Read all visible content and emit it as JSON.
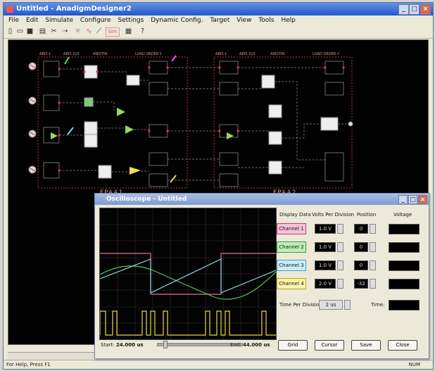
{
  "window": {
    "title": "Untitled - AnadigmDesigner2"
  },
  "menu": [
    "File",
    "Edit",
    "Simulate",
    "Configure",
    "Settings",
    "Dynamic Config.",
    "Target",
    "View",
    "Tools",
    "Help"
  ],
  "toolbar_icons": [
    "new-file-icon",
    "open-folder-icon",
    "save-icon",
    "print-icon",
    "cut-icon",
    "wire-icon",
    "delete-icon",
    "sine-wave-icon",
    "oscilloscope-icon",
    "simulate-icon",
    "chip-icon",
    "help-icon"
  ],
  "toolbar_labels": {
    "sim": "Sim"
  },
  "canvas": {
    "fpaa1_label": "FPAA1",
    "fpaa2_label": "FPAA2",
    "top_labels_1": [
      "ABIS 1",
      "ABIS 215",
      "ANISTIN",
      "LOAD ORDER 1"
    ],
    "top_labels_2": [
      "ABIS 1",
      "ABIS 215",
      "ANISTIN",
      "LOAD ORDER 2"
    ]
  },
  "status": {
    "left": "For Help, Press F1",
    "right": "NUM"
  },
  "oscilloscope": {
    "title": "Oscilloscope - Untitled",
    "headers": {
      "display": "Display Data",
      "volts": "Volts Per Division",
      "position": "Position",
      "voltage": "Voltage"
    },
    "channels": [
      {
        "label": "Channel 1",
        "volts": "1.0 V",
        "position": "0",
        "color": "#e66fa6",
        "bg": "#f4c3da"
      },
      {
        "label": "Channel 2",
        "volts": "1.0 V",
        "position": "0",
        "color": "#5bbf5b",
        "bg": "#bff0b0"
      },
      {
        "label": "Channel 3",
        "volts": "1.0 V",
        "position": "0",
        "color": "#8fd3e6",
        "bg": "#c9eef8"
      },
      {
        "label": "Channel 4",
        "volts": "2.0 V",
        "position": "-32",
        "color": "#e8d84a",
        "bg": "#fbf3a6"
      }
    ],
    "time_per_division_label": "Time Per Division:",
    "time_per_division": "2 us",
    "time_label": "Time:",
    "start_label": "Start:",
    "start_value": "24.000 us",
    "end_label": "End:",
    "end_value": "44.000 us",
    "buttons": {
      "grid": "Grid",
      "cursor": "Cursor",
      "save": "Save",
      "close": "Close"
    }
  }
}
